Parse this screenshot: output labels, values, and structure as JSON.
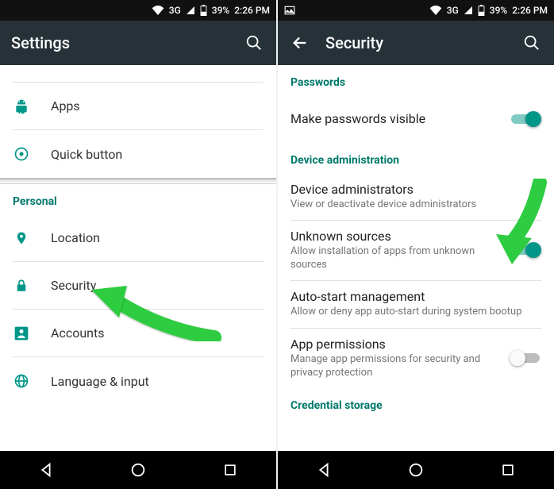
{
  "status": {
    "net_label": "3G",
    "battery": "39%",
    "time": "2:26 PM"
  },
  "left": {
    "title": "Settings",
    "top_items": [
      {
        "label": "Apps"
      },
      {
        "label": "Quick button"
      }
    ],
    "section_header": "Personal",
    "personal_items": [
      {
        "label": "Location"
      },
      {
        "label": "Security"
      },
      {
        "label": "Accounts"
      },
      {
        "label": "Language & input"
      }
    ]
  },
  "right": {
    "title": "Security",
    "pw_header": "Passwords",
    "pw_item": {
      "title": "Make passwords visible"
    },
    "da_header": "Device administration",
    "da_items": [
      {
        "title": "Device administrators",
        "sub": "View or deactivate device administrators"
      },
      {
        "title": "Unknown sources",
        "sub": "Allow installation of apps from unknown sources"
      },
      {
        "title": "Auto-start management",
        "sub": "Allow or deny app auto-start during system bootup"
      },
      {
        "title": "App permissions",
        "sub": "Manage app permissions for security and privacy protection"
      }
    ],
    "cs_header": "Credential storage"
  }
}
